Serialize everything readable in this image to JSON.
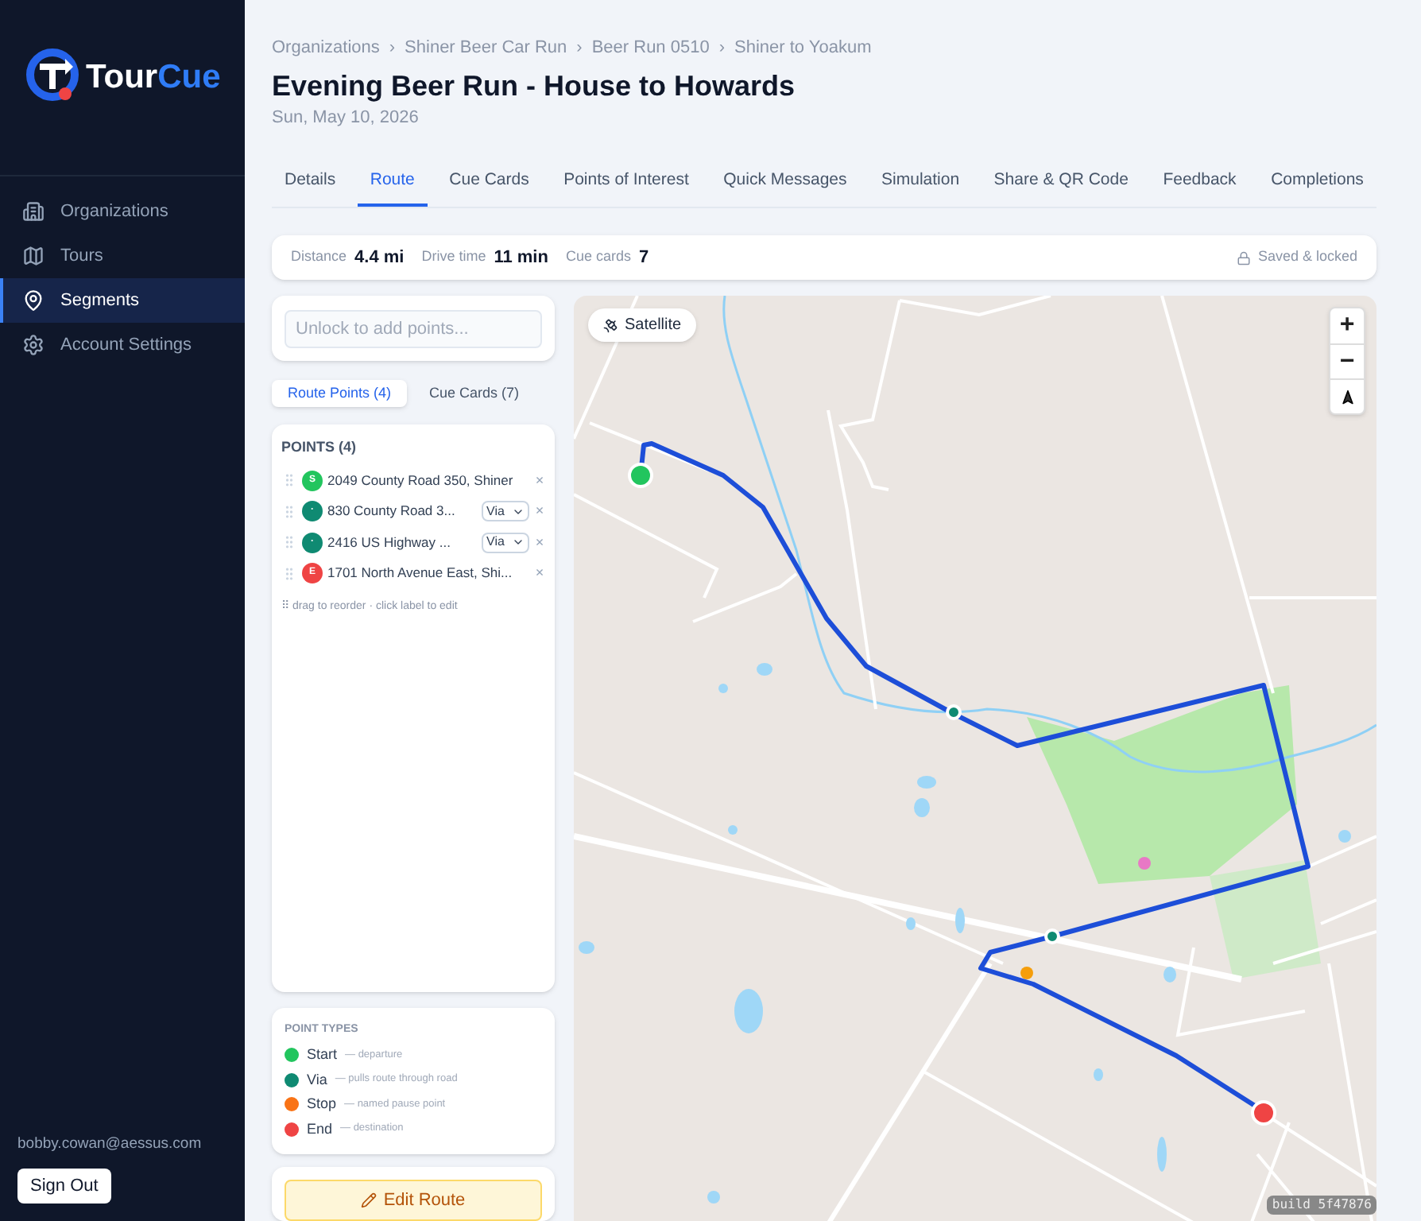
{
  "sidebar": {
    "logo": {
      "part1": "Tour",
      "part2": "Cue"
    },
    "items": [
      {
        "label": "Organizations",
        "selected": false
      },
      {
        "label": "Tours",
        "selected": false
      },
      {
        "label": "Segments",
        "selected": true
      },
      {
        "label": "Account Settings",
        "selected": false
      }
    ],
    "user_email": "bobby.cowan@aessus.com",
    "sign_out": "Sign Out"
  },
  "breadcrumbs": [
    "Organizations",
    "Shiner Beer Car Run",
    "Beer Run 0510",
    "Shiner to Yoakum"
  ],
  "breadcrumb_separator": "›",
  "title": "Evening Beer Run - House to Howards",
  "date": "Sun, May 10, 2026",
  "tabs": [
    {
      "label": "Details",
      "selected": false
    },
    {
      "label": "Route",
      "selected": true
    },
    {
      "label": "Cue Cards",
      "selected": false
    },
    {
      "label": "Points of Interest",
      "selected": false
    },
    {
      "label": "Quick Messages",
      "selected": false
    },
    {
      "label": "Simulation",
      "selected": false
    },
    {
      "label": "Share & QR Code",
      "selected": false
    },
    {
      "label": "Feedback",
      "selected": false
    },
    {
      "label": "Completions",
      "selected": false
    }
  ],
  "stats": [
    {
      "label": "Distance",
      "value": "4.4 mi"
    },
    {
      "label": "Drive time",
      "value": "11 min"
    },
    {
      "label": "Cue cards",
      "value": "7"
    }
  ],
  "lock_status": "Saved & locked",
  "search": {
    "placeholder": "Unlock to add points..."
  },
  "subtabs": [
    {
      "label": "Route Points (4)",
      "selected": true
    },
    {
      "label": "Cue Cards (7)",
      "selected": false
    }
  ],
  "points": {
    "heading": "POINTS (4)",
    "items": [
      {
        "badge": "S",
        "label": "2049 County Road 350, Shiner",
        "color": "#22c55e",
        "kind": "fixed",
        "remove": "×"
      },
      {
        "badge": "·",
        "label": "830 County Road 3...",
        "color": "#0f8a72",
        "kind": "select",
        "select_value": "Via",
        "remove": "×"
      },
      {
        "badge": "·",
        "label": "2416 US Highway ...",
        "color": "#0f8a72",
        "kind": "select",
        "select_value": "Via",
        "remove": "×"
      },
      {
        "badge": "E",
        "label": "1701 North Avenue East, Shi...",
        "color": "#ef4444",
        "kind": "fixed",
        "remove": "×"
      }
    ],
    "hint": "⠿ drag to reorder · click label to edit"
  },
  "point_types": {
    "heading": "POINT TYPES",
    "items": [
      {
        "name": "Start",
        "description": "— departure",
        "color": "#22c55e"
      },
      {
        "name": "Via",
        "description": "— pulls route through road",
        "color": "#0f8a72"
      },
      {
        "name": "Stop",
        "description": "— named pause point",
        "color": "#f97316"
      },
      {
        "name": "End",
        "description": "— destination",
        "color": "#ef4444"
      }
    ]
  },
  "edit_button": "Edit Route",
  "map": {
    "satellite_button": "Satellite",
    "zoom_in": "+",
    "zoom_out": "−",
    "build": "build 5f47876"
  }
}
